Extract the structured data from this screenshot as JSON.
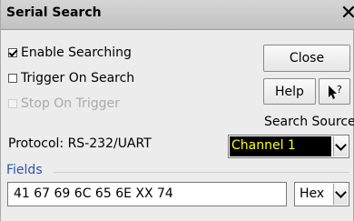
{
  "window": {
    "title": "Serial Search",
    "close_glyph": "✕"
  },
  "options": {
    "enable_searching": {
      "label": "Enable Searching",
      "checked": true
    },
    "trigger_on_search": {
      "label": "Trigger On Search",
      "checked": false
    },
    "stop_on_trigger": {
      "label": "Stop On Trigger",
      "checked": false,
      "enabled": false
    }
  },
  "buttons": {
    "close": "Close",
    "help": "Help",
    "whats_this_icon": "pointer-question-icon"
  },
  "search_source": {
    "label": "Search Source",
    "value": "Channel 1",
    "value_color": "#ffff00",
    "background": "#000000"
  },
  "protocol": {
    "text": "Protocol: RS-232/UART"
  },
  "fields": {
    "title": "Fields",
    "value": "41 67 69 6C 65 6E XX 74",
    "format": "Hex"
  }
}
